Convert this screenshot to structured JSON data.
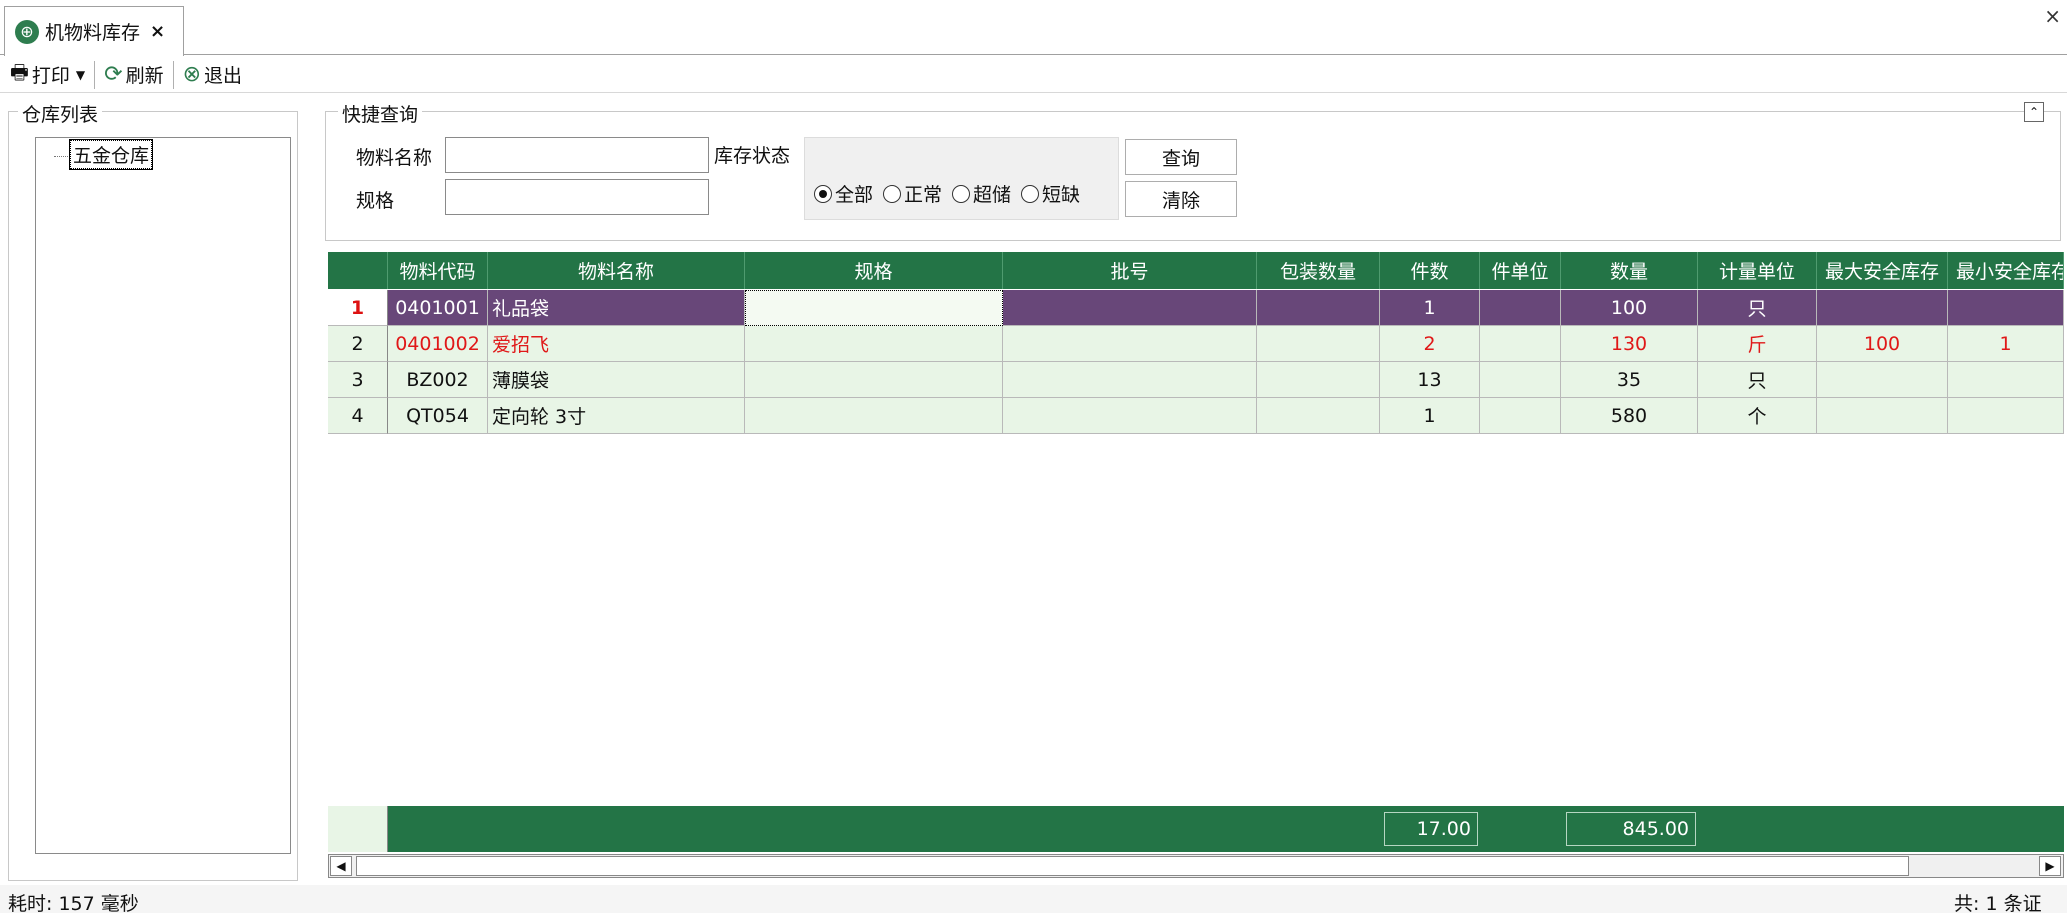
{
  "tab": {
    "label": "机物料库存",
    "close": "×"
  },
  "window": {
    "close": "×"
  },
  "toolbar": {
    "print": "打印",
    "refresh": "刷新",
    "exit": "退出"
  },
  "warehouse": {
    "group_title": "仓库列表",
    "nodes": [
      "五金仓库"
    ]
  },
  "query": {
    "group_title": "快捷查询",
    "name_label": "物料名称",
    "name_value": "",
    "spec_label": "规格",
    "spec_value": "",
    "status_label": "库存状态",
    "status_options": [
      "全部",
      "正常",
      "超储",
      "短缺"
    ],
    "status_selected": "全部",
    "search_button": "查询",
    "clear_button": "清除"
  },
  "grid": {
    "columns": [
      "物料代码",
      "物料名称",
      "规格",
      "批号",
      "包装数量",
      "件数",
      "件单位",
      "数量",
      "计量单位",
      "最大安全库存",
      "最小安全库存"
    ],
    "rows": [
      {
        "num": "1",
        "code": "0401001",
        "name": "礼品袋",
        "spec": "",
        "batch": "",
        "pack": "",
        "pieces": "1",
        "piece_unit": "",
        "qty": "100",
        "unit": "只",
        "max": "",
        "min": ""
      },
      {
        "num": "2",
        "code": "0401002",
        "name": "爱招飞",
        "spec": "",
        "batch": "",
        "pack": "",
        "pieces": "2",
        "piece_unit": "",
        "qty": "130",
        "unit": "斤",
        "max": "100",
        "min": "1"
      },
      {
        "num": "3",
        "code": "BZ002",
        "name": "薄膜袋",
        "spec": "",
        "batch": "",
        "pack": "",
        "pieces": "13",
        "piece_unit": "",
        "qty": "35",
        "unit": "只",
        "max": "",
        "min": ""
      },
      {
        "num": "4",
        "code": "QT054",
        "name": "定向轮 3寸",
        "spec": "",
        "batch": "",
        "pack": "",
        "pieces": "1",
        "piece_unit": "",
        "qty": "580",
        "unit": "个",
        "max": "",
        "min": ""
      }
    ],
    "totals": {
      "pieces": "17.00",
      "qty": "845.00"
    }
  },
  "colors": {
    "header_green": "#237446",
    "selected_row": "#684779",
    "row_bg": "#e8f5e6",
    "alert_text": "#e01818"
  },
  "status": {
    "elapsed": "耗时: 157 毫秒",
    "count": "共: 1 条证"
  }
}
